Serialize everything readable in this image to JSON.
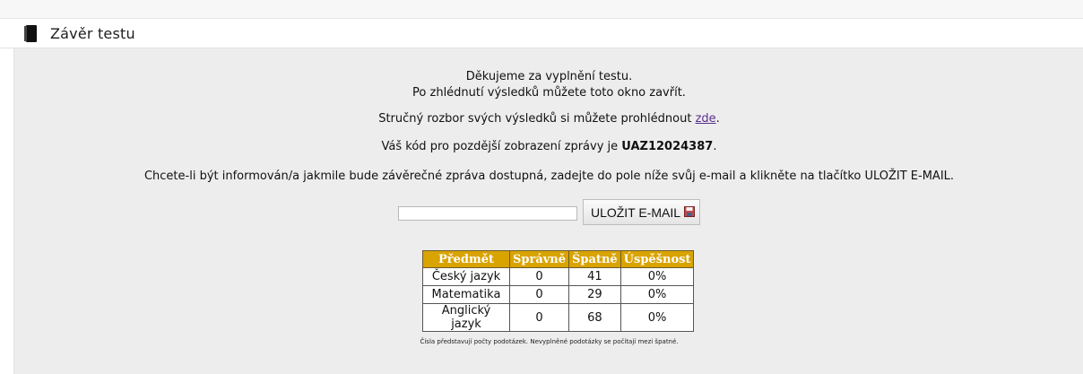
{
  "header": {
    "title": "Závěr testu",
    "icon": "book-icon"
  },
  "content": {
    "thanks_line1": "Děkujeme za vyplnění testu.",
    "thanks_line2": "Po zhlédnutí výsledků můžete toto okno zavřít.",
    "analysis_text": "Stručný rozbor svých výsledků si můžete prohlédnout ",
    "analysis_link": "zde",
    "analysis_end": ".",
    "code_text": "Váš kód pro pozdější zobrazení zprávy je ",
    "code_value": "UAZ12024387",
    "code_end": ".",
    "email_prompt": "Chcete-li být informován/a jakmile bude závěrečné zpráva dostupná, zadejte do pole níže svůj e-mail a klikněte na tlačítko ULOŽIT E-MAIL.",
    "email_value": "",
    "save_button_label": "ULOŽIT E-MAIL",
    "save_button_icon": "floppy-disk-icon"
  },
  "results_table": {
    "headers": [
      "Předmět",
      "Správně",
      "Špatně",
      "Úspěšnost"
    ],
    "rows": [
      [
        "Český jazyk",
        "0",
        "41",
        "0%"
      ],
      [
        "Matematika",
        "0",
        "29",
        "0%"
      ],
      [
        "Anglický jazyk",
        "0",
        "68",
        "0%"
      ]
    ],
    "header_color": "#d9a300"
  },
  "footnote": "Čísla představují počty podotázek. Nevyplněné podotázky se počítají mezi špatné."
}
